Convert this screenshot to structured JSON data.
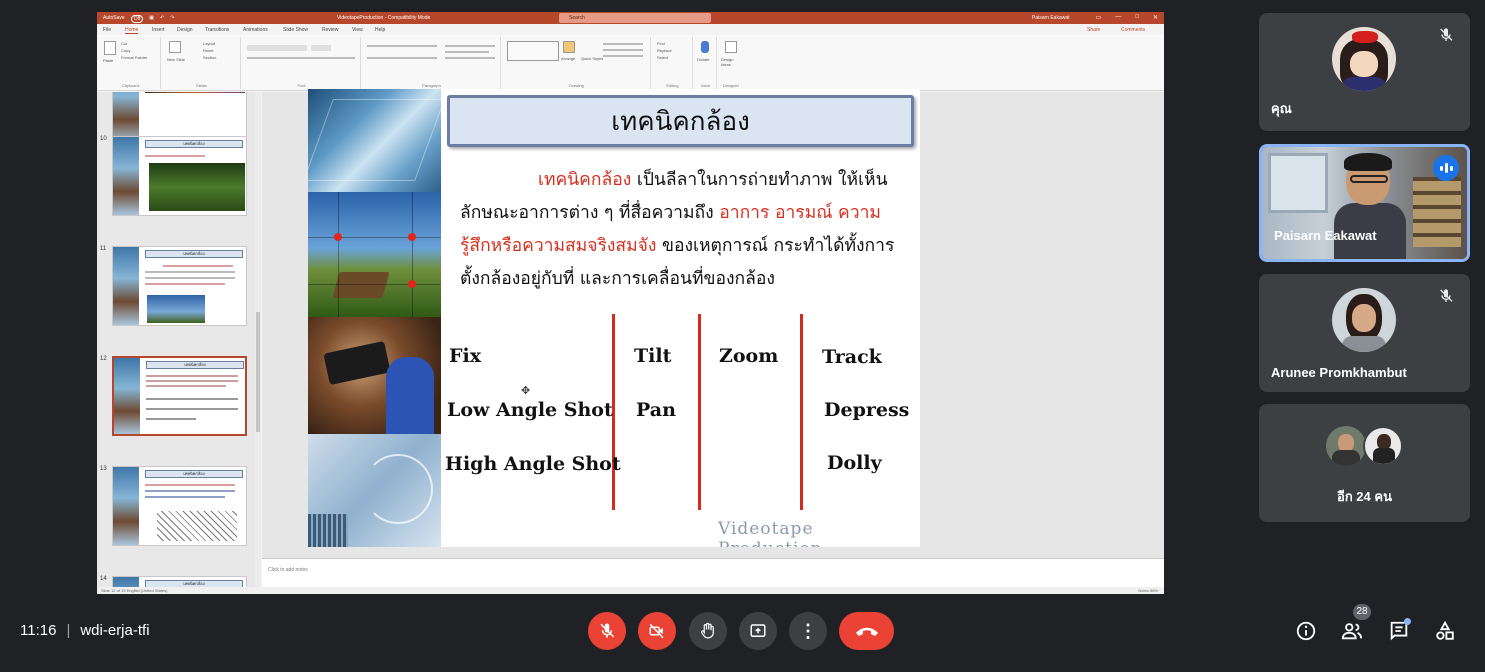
{
  "powerpoint": {
    "titlebar": {
      "autosave_label": "AutoSave",
      "autosave_state": "Off",
      "document_title": "VideotapeProduction  -  Compatibility Mode",
      "search_placeholder": "Search",
      "user_name": "Paisarn Eakawat",
      "user_initials": "PE"
    },
    "tabs": [
      "File",
      "Home",
      "Insert",
      "Design",
      "Transitions",
      "Animations",
      "Slide Show",
      "Review",
      "View",
      "Help"
    ],
    "active_tab": "Home",
    "share_label": "Share",
    "comments_label": "Comments",
    "ribbon_groups": [
      "Clipboard",
      "Slides",
      "Font",
      "Paragraph",
      "Drawing",
      "Editing",
      "Voice",
      "Designer"
    ],
    "ribbon_buttons": {
      "paste": "Paste",
      "cut": "Cut",
      "copy": "Copy",
      "format_painter": "Format Painter",
      "new_slide": "New Slide",
      "layout": "Layout",
      "reset": "Reset",
      "section": "Section",
      "arrange": "Arrange",
      "quick_styles": "Quick Styles",
      "find": "Find",
      "replace": "Replace",
      "select": "Select",
      "dictate": "Dictate",
      "design_ideas": "Design Ideas"
    },
    "thumbnails": [
      {
        "number": "10",
        "title": "เทคนิคกล้อง",
        "selected": false
      },
      {
        "number": "11",
        "title": "เทคนิคกล้อง",
        "selected": false
      },
      {
        "number": "12",
        "title": "เทคนิคกล้อง",
        "selected": true
      },
      {
        "number": "13",
        "title": "เทคนิคกล้อง",
        "selected": false
      },
      {
        "number": "14",
        "title": "เทคนิคกล้อง",
        "selected": false
      }
    ],
    "notes_placeholder": "Click to add notes",
    "status_left": "Slide 12 of 19    English (United States)",
    "status_right": "Notes    56%",
    "slide": {
      "title": "เทคนิคกล้อง",
      "body_red_1": "เทคนิคกล้อง",
      "body_1": " เป็นลีลาในการถ่ายทำภาพ ให้เห็นลักษณะอาการต่าง ๆ ที่สื่อความถึง ",
      "body_red_2": "อาการ อารมณ์ ความรู้สึกหรือความสมจริงสมจัง",
      "body_2": " ของเหตุการณ์ กระทำได้ทั้งการตั้งกล้องอยู่กับที่ และการเคลื่อนที่ของกล้อง",
      "terms": {
        "fix": "Fix",
        "low_angle": "Low Angle Shot",
        "high_angle": "High Angle Shot",
        "tilt": "Tilt",
        "pan": "Pan",
        "zoom": "Zoom",
        "track": "Track",
        "depress": "Depress",
        "dolly": "Dolly"
      },
      "watermark": "Videotape Production"
    }
  },
  "participants": [
    {
      "name": "คุณ",
      "muted": true,
      "avatar": "cartoon-girl-avatar"
    },
    {
      "name": "Paisarn Eakawat",
      "muted": false,
      "speaking": true
    },
    {
      "name": "Arunee Promkhambut",
      "muted": true
    },
    {
      "name": "อีก 24 คน"
    }
  ],
  "meeting": {
    "time": "11:16",
    "separator": "|",
    "code": "wdi-erja-tfi",
    "people_count": "28"
  },
  "colors": {
    "background": "#202124",
    "tile": "#3c4043",
    "danger": "#ea4335",
    "accent": "#8ab4f8",
    "speaking": "#1a73e8",
    "powerpoint_brand": "#b7472a",
    "slide_red": "#d72f1d"
  }
}
